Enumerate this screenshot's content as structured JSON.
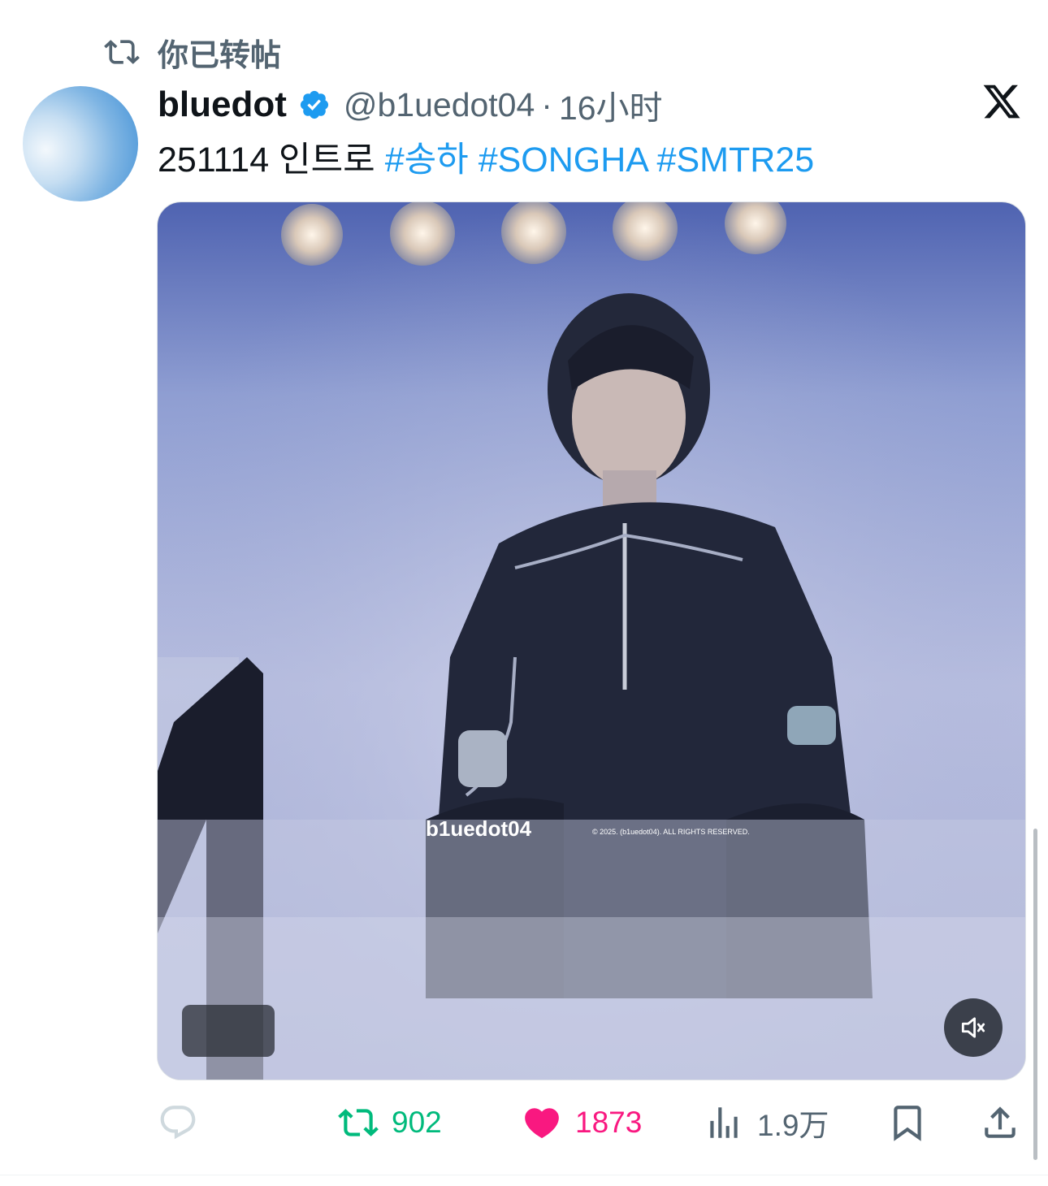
{
  "repost_notice": {
    "text": "你已转帖",
    "icon": "repost-icon"
  },
  "author": {
    "display_name": "bluedot",
    "verified": true,
    "handle": "@b1uedot04",
    "separator": "·",
    "time": "16小时",
    "avatar_colors": [
      "#f3f8fc",
      "#7fb5e3",
      "#3f8fd6"
    ]
  },
  "tweet": {
    "text_plain": "251114 인트로",
    "hashtags": [
      "#송하",
      "#SONGHA",
      "#SMTR25"
    ]
  },
  "media": {
    "watermark_brand": "b1uedot04",
    "watermark_copyright": "© 2025. (b1uedot04). ALL RIGHTS RESERVED.",
    "mute_icon": "volume-muted-icon"
  },
  "actions": {
    "reply": {
      "icon": "reply-icon",
      "count": ""
    },
    "repost": {
      "icon": "repost-icon",
      "count": "902"
    },
    "like": {
      "icon": "heart-icon",
      "count": "1873"
    },
    "views": {
      "icon": "views-chart-icon",
      "count": "1.9万"
    },
    "bookmark": {
      "icon": "bookmark-icon"
    },
    "share": {
      "icon": "share-icon"
    }
  },
  "colors": {
    "link": "#1d9bf0",
    "secondary": "#536471",
    "repost_active": "#00ba7c",
    "like_active": "#f91880",
    "verified_badge": "#1d9bf0"
  }
}
